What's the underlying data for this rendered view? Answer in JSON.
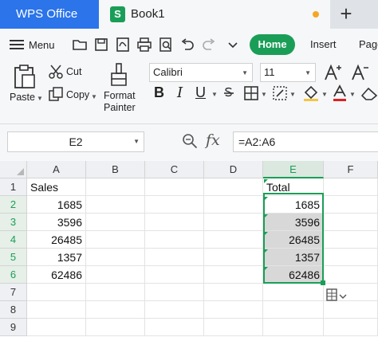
{
  "titlebar": {
    "app_tab": "WPS Office",
    "doc_tab": "Book1",
    "doc_icon_letter": "S",
    "new_tab_symbol": "+"
  },
  "menu": {
    "menu_label": "Menu",
    "quick_access_icons": [
      "open-folder-icon",
      "save-icon",
      "export-pdf-icon",
      "print-icon",
      "print-preview-icon",
      "undo-icon",
      "redo-icon",
      "more-dropdown-icon"
    ],
    "tabs": [
      "Home",
      "Insert",
      "Page"
    ],
    "active_tab": "Home",
    "accent_color": "#1a9e57"
  },
  "ribbon": {
    "paste_label": "Paste",
    "cut_label": "Cut",
    "copy_label": "Copy",
    "format_painter_line1": "Format",
    "format_painter_line2": "Painter",
    "font_name": "Calibri",
    "font_size": "11",
    "bold": "B",
    "italic": "I",
    "underline": "U",
    "font_color": "#e02020"
  },
  "formula_bar": {
    "name_box": "E2",
    "fx_label": "fx",
    "formula": "=A2:A6"
  },
  "sheet": {
    "columns": [
      "A",
      "B",
      "C",
      "D",
      "E",
      "F"
    ],
    "rows": [
      "1",
      "2",
      "3",
      "4",
      "5",
      "6",
      "7",
      "8",
      "9"
    ],
    "selected_column": "E",
    "selected_rows": [
      "2",
      "3",
      "4",
      "5",
      "6"
    ],
    "a1": "Sales",
    "e1": "Total",
    "sales": [
      "1685",
      "3596",
      "26485",
      "1357",
      "62486"
    ],
    "totals": [
      "1685",
      "3596",
      "26485",
      "1357",
      "62486"
    ]
  }
}
